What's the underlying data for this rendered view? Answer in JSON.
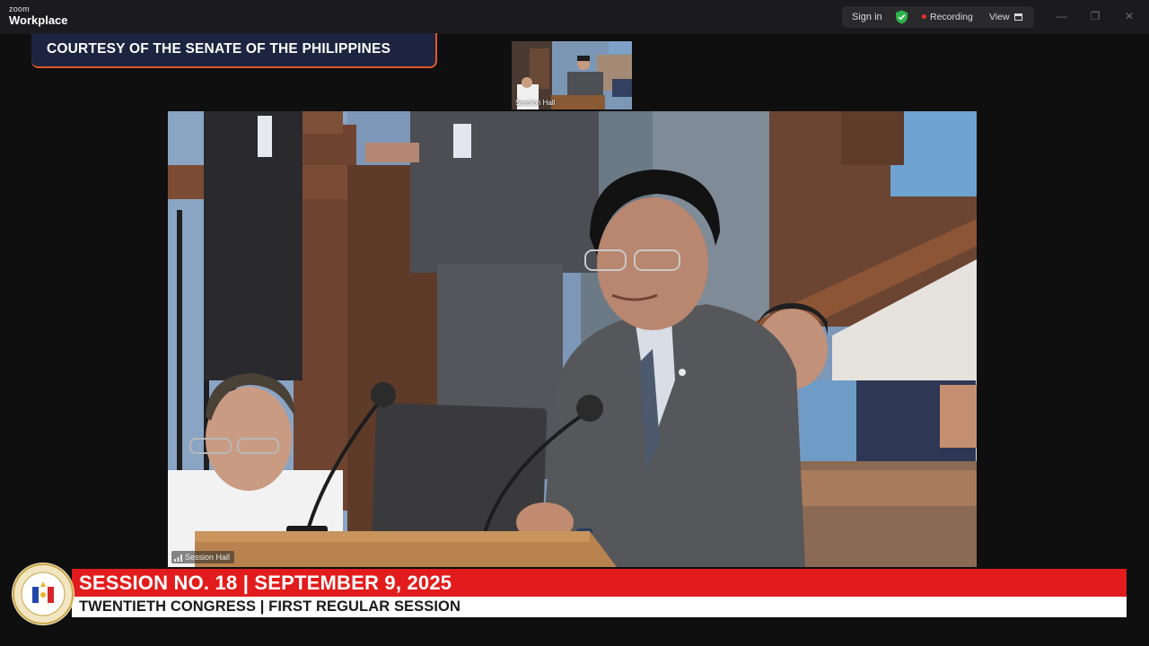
{
  "titlebar": {
    "brand_small": "zoom",
    "brand_main": "Workplace",
    "sign_in": "Sign in",
    "recording": "Recording",
    "view": "View",
    "minimize": "—",
    "restore": "❐",
    "close": "✕"
  },
  "banner": {
    "courtesy": "COURTESY OF THE SENATE OF THE PHILIPPINES"
  },
  "thumbnail": {
    "label": "Session Hall"
  },
  "main_video": {
    "label": "Session Hall"
  },
  "lower_third": {
    "title": "SESSION NO. 18 | SEPTEMBER 9, 2025",
    "subtitle": "TWENTIETH CONGRESS | FIRST REGULAR SESSION"
  },
  "colors": {
    "accent_orange": "#e2582b",
    "banner_navy": "#1d2440",
    "lower_red": "#e21c1c",
    "recording_red": "#e5302c",
    "shield_green": "#2bb34b"
  },
  "icons": [
    "shield-check-icon",
    "recording-dot-icon",
    "view-grid-icon",
    "signal-bars-icon",
    "senate-seal-icon"
  ]
}
